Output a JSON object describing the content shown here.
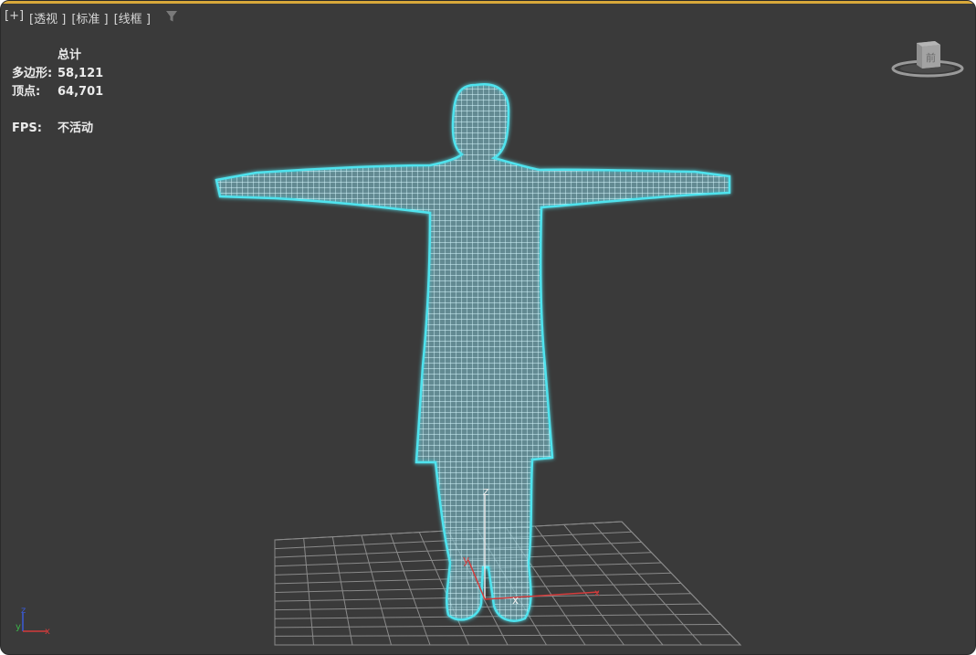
{
  "viewport": {
    "labels": [
      "[+]",
      "[透视 ]",
      "[标准 ]",
      "[线框 ]"
    ],
    "filter_icon": "filter-icon"
  },
  "stats": {
    "header": "总计",
    "polygons_label": "多边形:",
    "polygons_value": "58,121",
    "vertices_label": "顶点:",
    "vertices_value": "64,701",
    "fps_label": "FPS:",
    "fps_value": "不活动"
  },
  "viewcube": {
    "face_label": "前"
  },
  "gizmo": {
    "z_label": "z",
    "y_label": "y",
    "x_label": "x"
  },
  "tripod": {
    "z_label": "z",
    "y_label": "y",
    "x_label": "x"
  },
  "colors": {
    "background": "#3a3a3a",
    "active_border": "#d8a83a",
    "wireframe": "#c8f4ff",
    "selection_glow": "#4fe3ee",
    "grid": "#8a8a8a",
    "axis_x": "#d33b3b",
    "axis_y": "#3bb34a",
    "axis_z": "#3b5bd8"
  }
}
